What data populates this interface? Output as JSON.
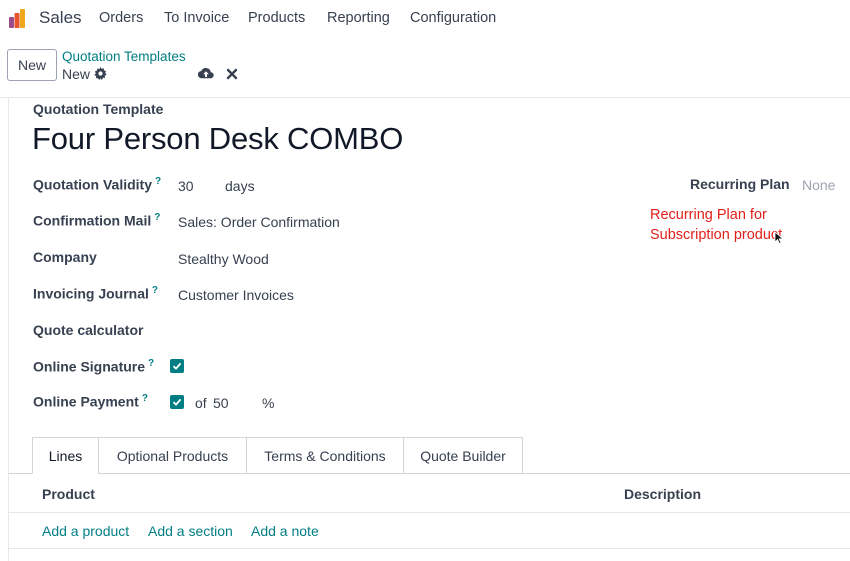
{
  "topbar": {
    "app_name": "Sales",
    "menu": [
      "Orders",
      "To Invoice",
      "Products",
      "Reporting",
      "Configuration"
    ],
    "logo_colors": [
      "#f0a818",
      "#e8542c",
      "#9b4d8b",
      "#3c6fb6"
    ]
  },
  "control_panel": {
    "new_button": "New",
    "breadcrumb_parent": "Quotation Templates",
    "breadcrumb_current": "New",
    "icons": [
      "gear-icon",
      "cloud-upload-icon",
      "close-icon"
    ]
  },
  "form": {
    "subtitle": "Quotation Template",
    "title": "Four Person Desk COMBO",
    "fields": {
      "validity": {
        "label": "Quotation Validity",
        "help": "?",
        "value": "30",
        "unit": "days"
      },
      "confirmation_mail": {
        "label": "Confirmation Mail",
        "help": "?",
        "value": "Sales: Order Confirmation"
      },
      "company": {
        "label": "Company",
        "value": "Stealthy Wood"
      },
      "invoicing_journal": {
        "label": "Invoicing Journal",
        "help": "?",
        "value": "Customer Invoices"
      },
      "quote_calculator": {
        "label": "Quote calculator"
      },
      "online_signature": {
        "label": "Online Signature",
        "help": "?",
        "checked": true
      },
      "online_payment": {
        "label": "Online Payment",
        "help": "?",
        "checked": true,
        "of_label": "of",
        "value": "50",
        "unit": "%"
      }
    },
    "recurring_plan": {
      "label": "Recurring Plan",
      "value": "None"
    },
    "annotation": "Recurring Plan for Subscription product"
  },
  "tabs": [
    "Lines",
    "Optional Products",
    "Terms & Conditions",
    "Quote Builder"
  ],
  "lines_table": {
    "columns": [
      "Product",
      "Description"
    ],
    "actions": [
      "Add a product",
      "Add a section",
      "Add a note"
    ]
  },
  "colors": {
    "accent": "#017e84",
    "annotation": "#e0201b"
  }
}
